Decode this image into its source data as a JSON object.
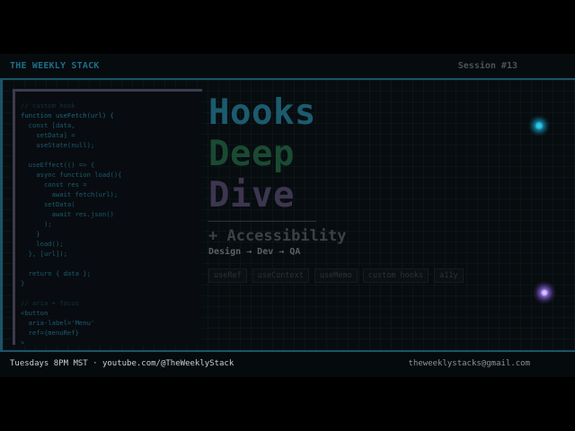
{
  "header": {
    "brand": "THE WEEKLY STACK",
    "session": "Session #13"
  },
  "code_lines": [
    {
      "text": "// custom hook",
      "cls": "cm"
    },
    {
      "text": "function useFetch(url) {",
      "cls": "kw"
    },
    {
      "text": "  const [data,",
      "cls": ""
    },
    {
      "text": "    setData] =",
      "cls": ""
    },
    {
      "text": "    useState(null);",
      "cls": ""
    },
    {
      "text": "",
      "cls": ""
    },
    {
      "text": "  useEffect(() => {",
      "cls": ""
    },
    {
      "text": "    async function load(){",
      "cls": ""
    },
    {
      "text": "      const res =",
      "cls": ""
    },
    {
      "text": "        await fetch(url);",
      "cls": ""
    },
    {
      "text": "      setData(",
      "cls": ""
    },
    {
      "text": "        await res.json()",
      "cls": ""
    },
    {
      "text": "      );",
      "cls": ""
    },
    {
      "text": "    }",
      "cls": ""
    },
    {
      "text": "    load();",
      "cls": ""
    },
    {
      "text": "  }, [url]);",
      "cls": ""
    },
    {
      "text": "",
      "cls": ""
    },
    {
      "text": "  return { data };",
      "cls": ""
    },
    {
      "text": "}",
      "cls": ""
    },
    {
      "text": "",
      "cls": ""
    },
    {
      "text": "// aria + focus",
      "cls": "cm"
    },
    {
      "text": "<button",
      "cls": ""
    },
    {
      "text": "  aria-label='Menu'",
      "cls": ""
    },
    {
      "text": "  ref={menuRef}",
      "cls": ""
    },
    {
      "text": ">",
      "cls": ""
    }
  ],
  "title": {
    "line1": "Hooks",
    "line2": "Deep",
    "line3": "Dive"
  },
  "subtitle": "+ Accessibility",
  "flow": "Design → Dev → QA",
  "tags": [
    "useRef",
    "useContext",
    "useMemo",
    "custom hooks",
    "a11y"
  ],
  "footer": {
    "schedule": "Tuesdays 8PM MST · youtube.com/@TheWeeklyStack",
    "email": "theweeklystacks@gmail.com"
  },
  "colors": {
    "accent_teal": "#1c5366",
    "glow_cyan": "#2fc7e8",
    "glow_purple": "#6b4fb0"
  }
}
